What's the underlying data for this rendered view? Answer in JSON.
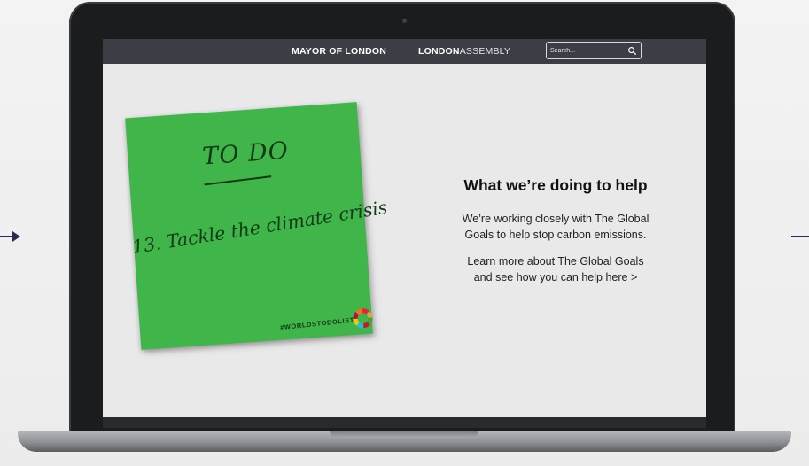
{
  "header": {
    "brand_mayor": "MAYOR OF LONDON",
    "brand_assembly_bold": "LONDON",
    "brand_assembly_light": "ASSEMBLY",
    "search_placeholder": "Search..."
  },
  "sticky_note": {
    "title": "TO DO",
    "task": "13. Tackle the climate crisis",
    "hashtag": "#WORLDSTODOLIST",
    "color": "#3fb54a"
  },
  "content": {
    "heading": "What we’re doing to help",
    "para1_line1": "We’re working closely with The Global",
    "para1_line2": "Goals to help stop carbon emissions.",
    "para2_line1": "Learn more about The Global Goals",
    "para2_line2": "and see how you can help here >"
  },
  "colors": {
    "topbar": "#3b3f45",
    "screen_bg": "#e9e9ea",
    "accent_dark": "#2c2c52"
  },
  "icons": [
    "arrow-right-icon",
    "search-icon",
    "sdg-wheel-icon"
  ]
}
